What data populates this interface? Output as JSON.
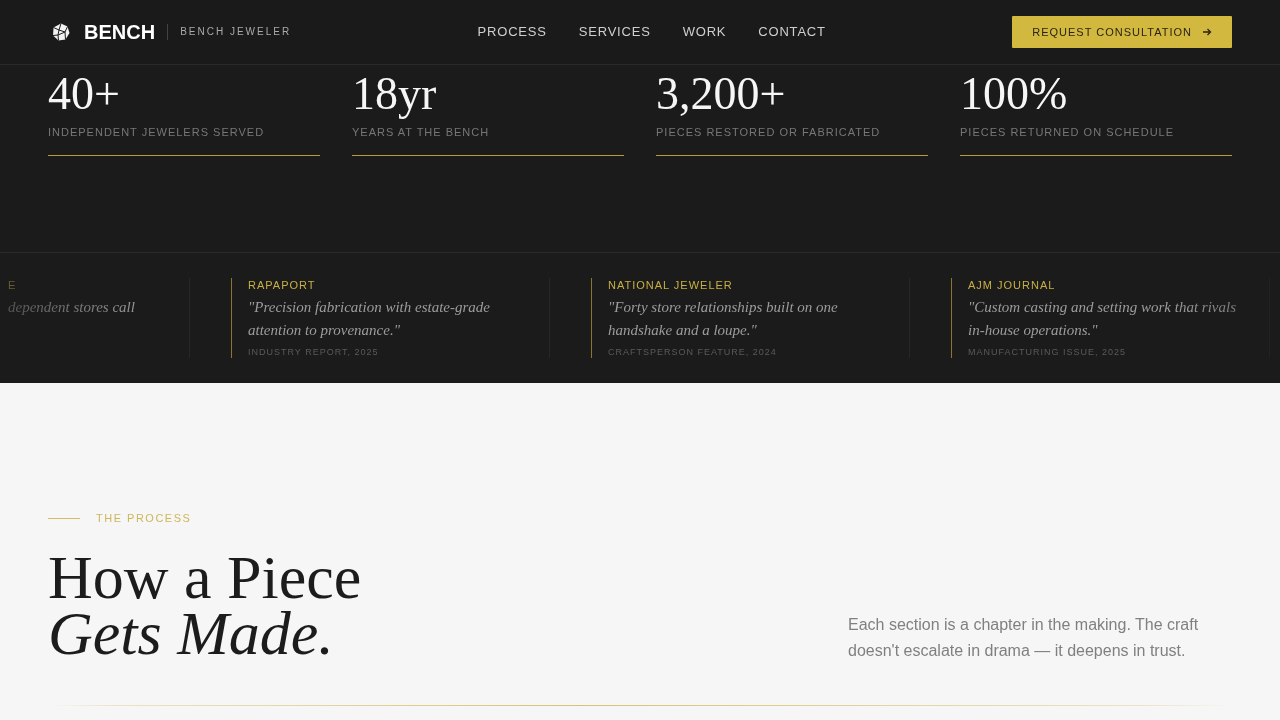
{
  "header": {
    "brand": "BENCH",
    "tagline": "BENCH JEWELER",
    "nav": [
      "PROCESS",
      "SERVICES",
      "WORK",
      "CONTACT"
    ],
    "cta": "REQUEST CONSULTATION"
  },
  "stats": [
    {
      "value": "40+",
      "label": "INDEPENDENT JEWELERS SERVED"
    },
    {
      "value": "18yr",
      "label": "YEARS AT THE BENCH"
    },
    {
      "value": "3,200+",
      "label": "PIECES RESTORED OR FABRICATED"
    },
    {
      "value": "100%",
      "label": "PIECES RETURNED ON SCHEDULE"
    }
  ],
  "press": [
    {
      "outlet": "E",
      "quote": "dependent stores call"
    },
    {
      "outlet": "RAPAPORT",
      "quote": "\"Precision fabrication with estate-grade attention to provenance.\"",
      "source": "INDUSTRY REPORT, 2025"
    },
    {
      "outlet": "NATIONAL JEWELER",
      "quote": "\"Forty store relationships built on one handshake and a loupe.\"",
      "source": "CRAFTSPERSON FEATURE, 2024"
    },
    {
      "outlet": "AJM JOURNAL",
      "quote": "\"Custom casting and setting work that rivals in-house operations.\"",
      "source": "MANUFACTURING ISSUE, 2025"
    }
  ],
  "process": {
    "eyebrow": "THE PROCESS",
    "heading": "How a Piece *Gets Made.*",
    "intro": "Each section is a chapter in the making. The craft doesn't escalate in drama — it deepens in trust."
  }
}
